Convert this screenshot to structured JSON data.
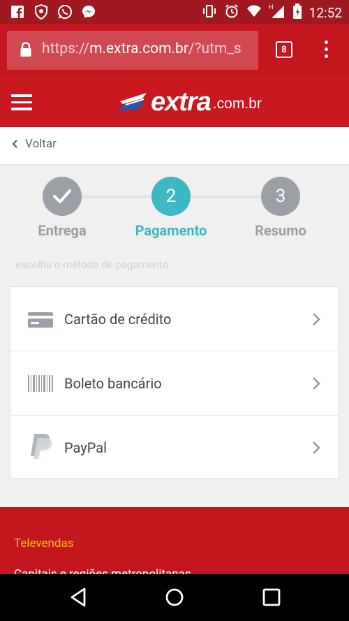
{
  "status_bar": {
    "time": "12:52",
    "icons": [
      "facebook-icon",
      "shield-icon",
      "whatsapp-icon",
      "messenger-icon",
      "vibrate-icon",
      "alarm-icon",
      "wifi-icon",
      "signal-icon",
      "battery-icon"
    ]
  },
  "browser": {
    "url_scheme": "https://",
    "url_host": "m.extra.com.br",
    "url_path": "/?utm_s",
    "tab_count": "8"
  },
  "header": {
    "logo_text": "extra",
    "logo_domain": ".com.br"
  },
  "back_label": "Voltar",
  "stepper": {
    "steps": [
      {
        "label": "Entrega",
        "state": "done",
        "number": ""
      },
      {
        "label": "Pagamento",
        "state": "active",
        "number": "2"
      },
      {
        "label": "Resumo",
        "state": "pending",
        "number": "3"
      }
    ]
  },
  "hint": "escolha o método de pagamento",
  "payment_methods": [
    {
      "label": "Cartão de crédito",
      "icon": "credit-card-icon"
    },
    {
      "label": "Boleto bancário",
      "icon": "barcode-icon"
    },
    {
      "label": "PayPal",
      "icon": "paypal-icon"
    }
  ],
  "footer": {
    "title": "Televendas",
    "text": "Capitais e regiões metropolitanas"
  },
  "colors": {
    "brand_red": "#c8171f",
    "step_active": "#3db8c4",
    "step_inactive": "#9aa0a6",
    "footer_yellow": "#f5c400"
  }
}
